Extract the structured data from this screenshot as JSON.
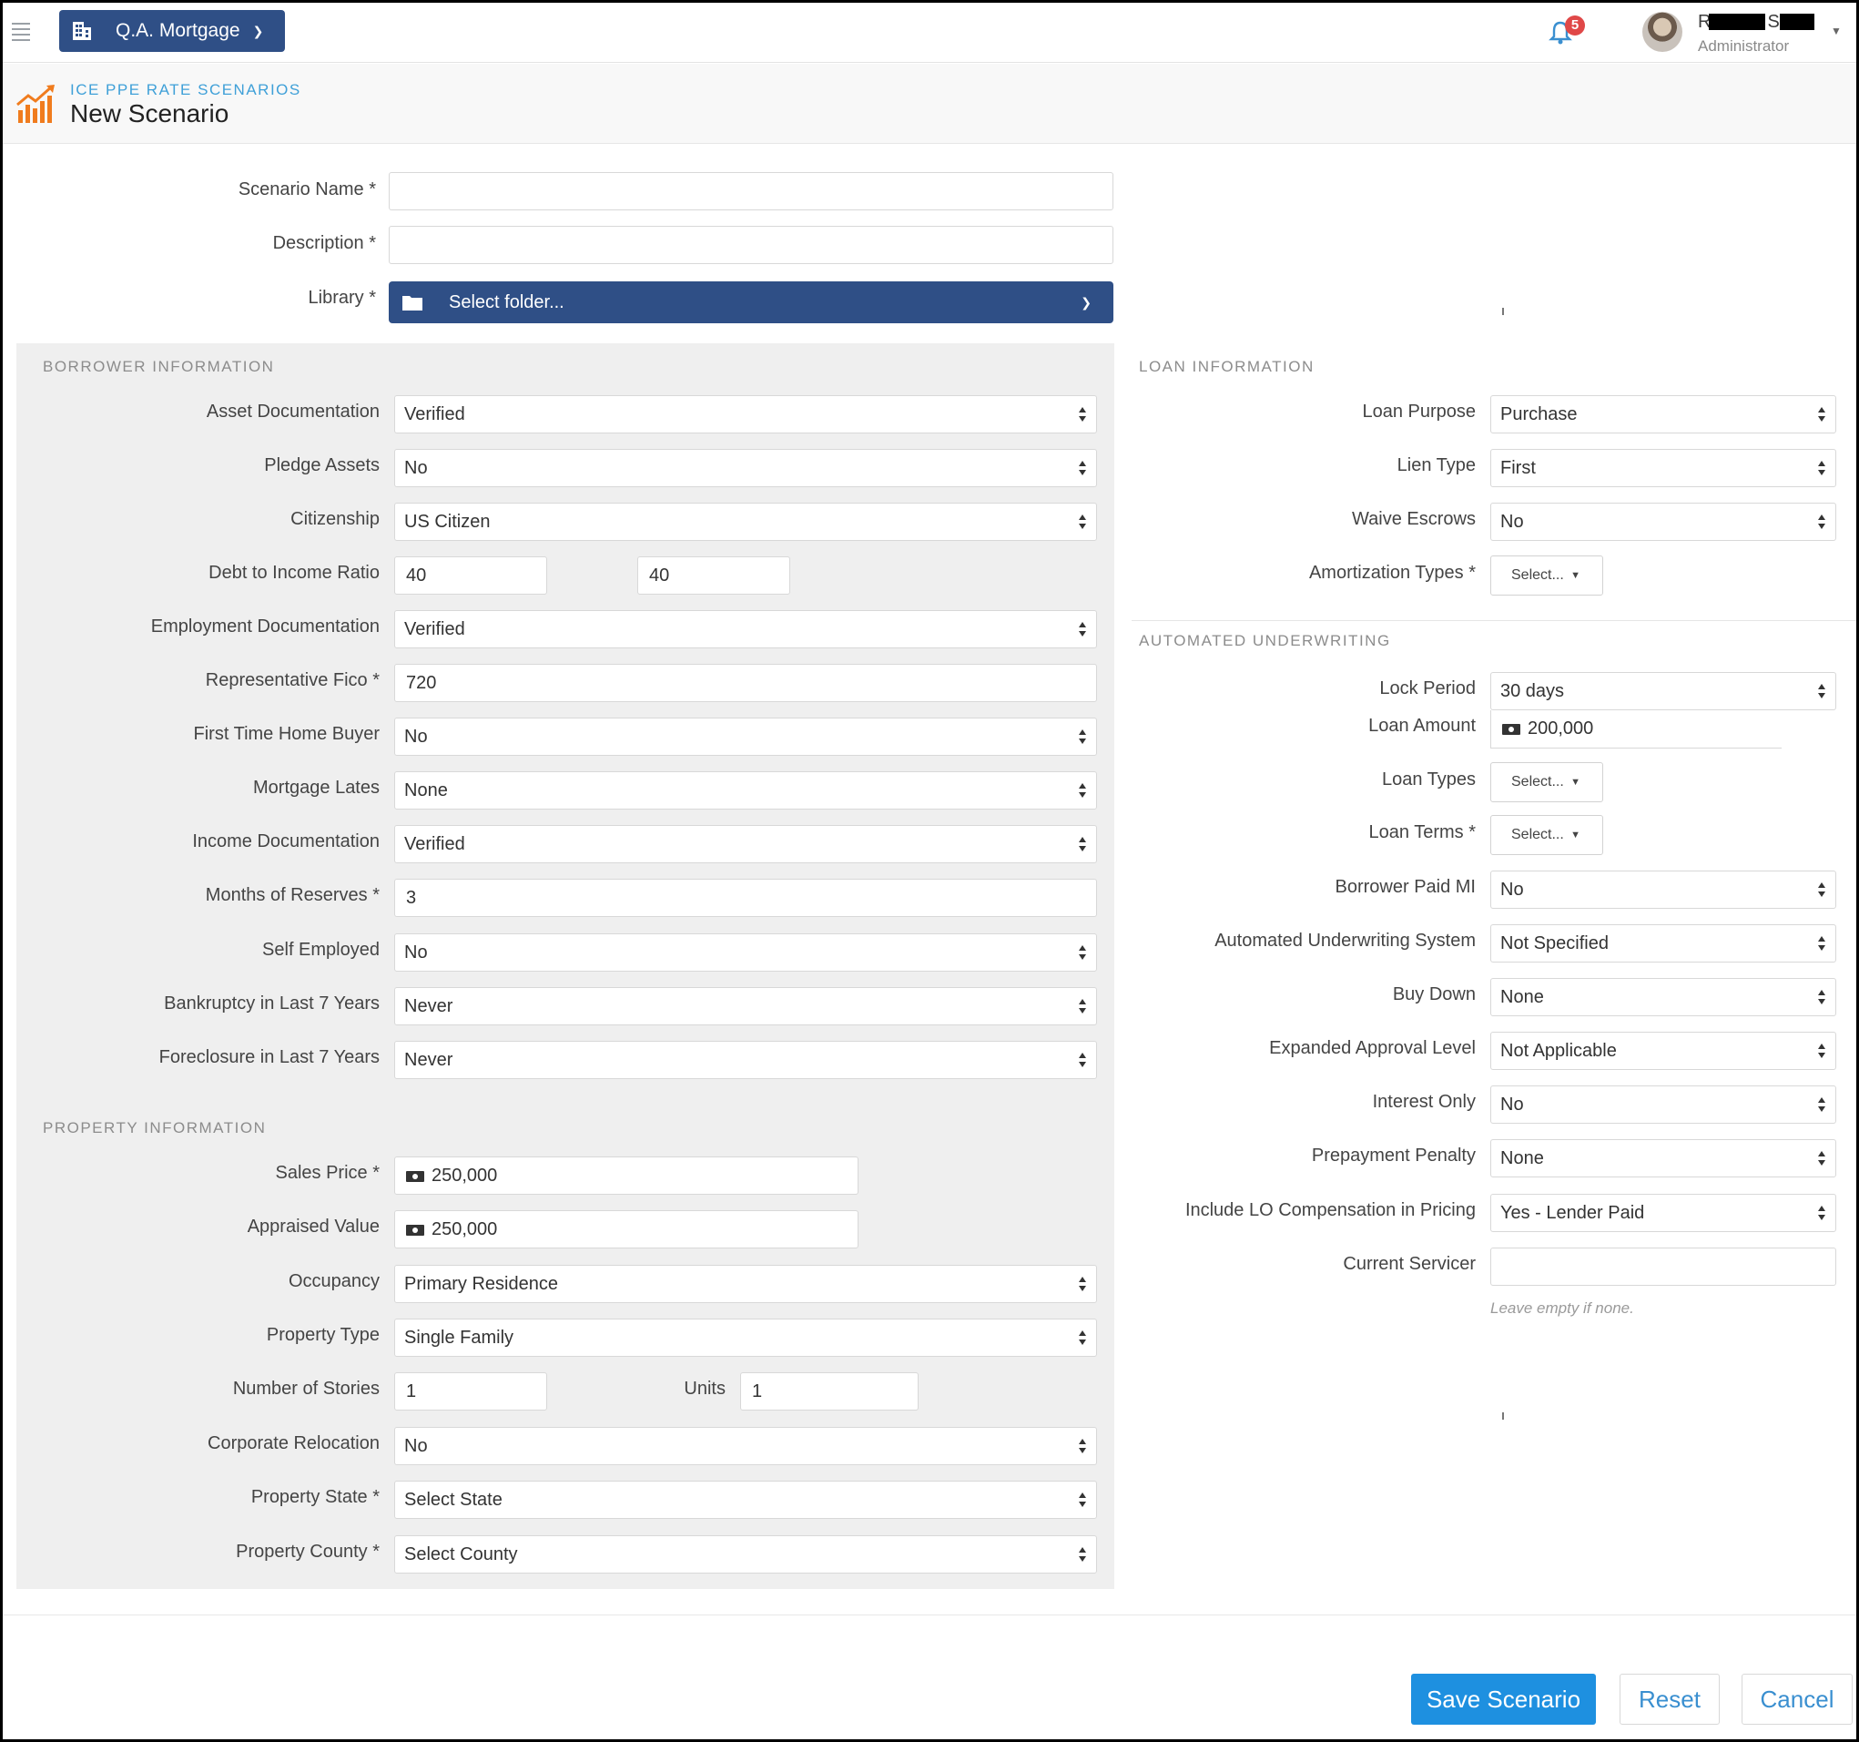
{
  "topbar": {
    "org_name": "Q.A. Mortgage",
    "notification_count": "5",
    "user_initial_1": "R",
    "user_initial_2": "S",
    "user_role": "Administrator"
  },
  "header": {
    "breadcrumb": "ICE PPE RATE SCENARIOS",
    "title": "New Scenario"
  },
  "scenario": {
    "name_label": "Scenario Name *",
    "name_value": "",
    "description_label": "Description *",
    "description_value": "",
    "library_label": "Library *",
    "library_value": "Select folder..."
  },
  "borrower": {
    "section_title": "BORROWER INFORMATION",
    "fields": [
      {
        "label": "Asset Documentation",
        "value": "Verified"
      },
      {
        "label": "Pledge Assets",
        "value": "No"
      },
      {
        "label": "Citizenship",
        "value": "US Citizen"
      },
      {
        "label": "Debt to Income Ratio",
        "value": "40",
        "value2": "40"
      },
      {
        "label": "Employment Documentation",
        "value": "Verified"
      },
      {
        "label": "Representative Fico *",
        "value": "720"
      },
      {
        "label": "First Time Home Buyer",
        "value": "No"
      },
      {
        "label": "Mortgage Lates",
        "value": "None"
      },
      {
        "label": "Income Documentation",
        "value": "Verified"
      },
      {
        "label": "Months of Reserves *",
        "value": "3"
      },
      {
        "label": "Self Employed",
        "value": "No"
      },
      {
        "label": "Bankruptcy in Last 7 Years",
        "value": "Never"
      },
      {
        "label": "Foreclosure in Last 7 Years",
        "value": "Never"
      }
    ]
  },
  "property": {
    "section_title": "PROPERTY INFORMATION",
    "fields": [
      {
        "label": "Sales Price *",
        "value": "250,000"
      },
      {
        "label": "Appraised Value",
        "value": "250,000"
      },
      {
        "label": "Occupancy",
        "value": "Primary Residence"
      },
      {
        "label": "Property Type",
        "value": "Single Family"
      },
      {
        "label": "Number of Stories",
        "value": "1",
        "label2": "Units",
        "value2": "1"
      },
      {
        "label": "Corporate Relocation",
        "value": "No"
      },
      {
        "label": "Property State *",
        "value": "Select State"
      },
      {
        "label": "Property County *",
        "value": "Select County"
      }
    ]
  },
  "loan": {
    "section_title": "LOAN INFORMATION",
    "fields": [
      {
        "label": "Loan Purpose",
        "value": "Purchase"
      },
      {
        "label": "Lien Type",
        "value": "First"
      },
      {
        "label": "Waive Escrows",
        "value": "No"
      },
      {
        "label": "Amortization Types *",
        "value": "Select..."
      }
    ]
  },
  "underwriting": {
    "section_title": "AUTOMATED UNDERWRITING",
    "fields": [
      {
        "label": "Lock Period",
        "value": "30 days"
      },
      {
        "label": "Loan Amount",
        "value": "200,000"
      },
      {
        "label": "Loan Types",
        "value": "Select..."
      },
      {
        "label": "Loan Terms *",
        "value": "Select..."
      },
      {
        "label": "Borrower Paid MI",
        "value": "No"
      },
      {
        "label": "Automated Underwriting System",
        "value": "Not Specified"
      },
      {
        "label": "Buy Down",
        "value": "None"
      },
      {
        "label": "Expanded Approval Level",
        "value": "Not Applicable"
      },
      {
        "label": "Interest Only",
        "value": "No"
      },
      {
        "label": "Prepayment Penalty",
        "value": "None"
      },
      {
        "label": "Include LO Compensation in Pricing",
        "value": "Yes - Lender Paid"
      },
      {
        "label": "Current Servicer",
        "value": ""
      }
    ],
    "servicer_hint": "Leave empty if none."
  },
  "footer": {
    "save_label": "Save Scenario",
    "reset_label": "Reset",
    "cancel_label": "Cancel"
  }
}
